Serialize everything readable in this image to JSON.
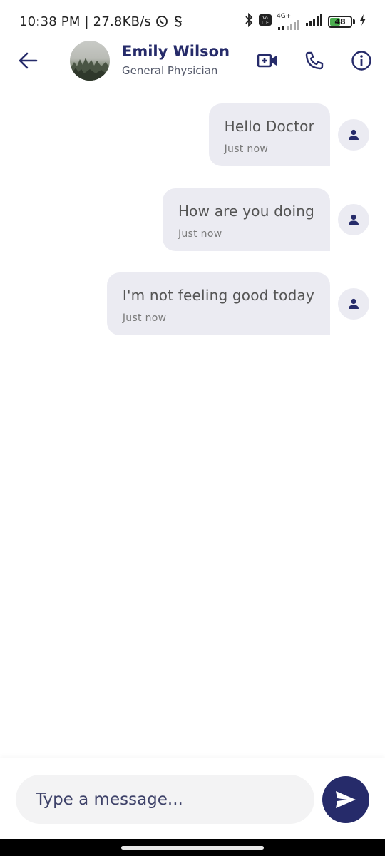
{
  "status_bar": {
    "time_speed": "10:38 PM | 27.8KB/s",
    "network_label": "4G+",
    "volte_label": "Vo LTE",
    "battery_level": "48"
  },
  "header": {
    "doctor_name": "Emily Wilson",
    "doctor_role": "General Physician",
    "icons": [
      "arrow-back-icon",
      "video-call-icon",
      "phone-icon",
      "info-icon"
    ]
  },
  "messages": [
    {
      "text": "Hello Doctor",
      "time": "Just now"
    },
    {
      "text": "How are you doing",
      "time": "Just now"
    },
    {
      "text": "I'm not feeling good today",
      "time": "Just now"
    }
  ],
  "composer": {
    "placeholder": "Type a message..."
  },
  "colors": {
    "brand": "#262b6a",
    "bubble": "#ebebf2",
    "input_bg": "#f3f3f4",
    "battery": "#4caf50"
  }
}
